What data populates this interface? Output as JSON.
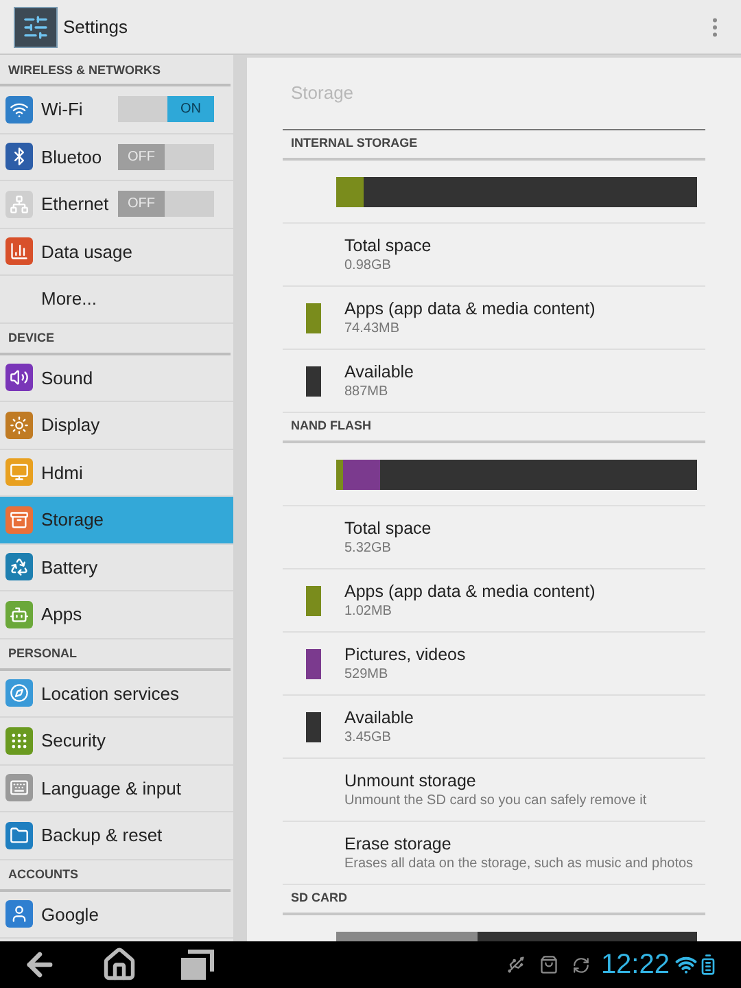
{
  "action_bar": {
    "title": "Settings"
  },
  "sidebar": {
    "sections": [
      {
        "header": "WIRELESS & NETWORKS",
        "items": [
          {
            "label": "Wi-Fi",
            "kind": "toggle",
            "on": true,
            "toggle_label": "ON",
            "selected": false
          },
          {
            "label": "Bluetoo",
            "kind": "toggle",
            "on": false,
            "toggle_label": "OFF",
            "selected": false
          },
          {
            "label": "Ethernet",
            "kind": "toggle",
            "on": false,
            "toggle_label": "OFF",
            "selected": false
          },
          {
            "label": "Data usage",
            "kind": "item",
            "selected": false
          },
          {
            "label": "More...",
            "kind": "item",
            "selected": false
          }
        ]
      },
      {
        "header": "DEVICE",
        "items": [
          {
            "label": "Sound",
            "kind": "item",
            "selected": false
          },
          {
            "label": "Display",
            "kind": "item",
            "selected": false
          },
          {
            "label": "Hdmi",
            "kind": "item",
            "selected": false
          },
          {
            "label": "Storage",
            "kind": "item",
            "selected": true
          },
          {
            "label": "Battery",
            "kind": "item",
            "selected": false
          },
          {
            "label": "Apps",
            "kind": "item",
            "selected": false
          }
        ]
      },
      {
        "header": "PERSONAL",
        "items": [
          {
            "label": "Location services",
            "kind": "item",
            "selected": false
          },
          {
            "label": "Security",
            "kind": "item",
            "selected": false
          },
          {
            "label": "Language & input",
            "kind": "item",
            "selected": false
          },
          {
            "label": "Backup & reset",
            "kind": "item",
            "selected": false
          }
        ]
      },
      {
        "header": "ACCOUNTS",
        "items": [
          {
            "label": "Google",
            "kind": "item",
            "selected": false
          }
        ]
      }
    ]
  },
  "storage": {
    "title": "Storage",
    "sections": [
      {
        "header": "INTERNAL STORAGE",
        "bar": [
          {
            "color": "#7a8c1c",
            "level": 0.075
          }
        ],
        "rows": [
          {
            "title": "Total space",
            "summary": "0.98GB"
          },
          {
            "title": "Apps (app data & media content)",
            "summary": "74.43MB",
            "color": "#7a8c1c"
          },
          {
            "title": "Available",
            "summary": "887MB",
            "color": "#333333"
          }
        ]
      },
      {
        "header": "NAND FLASH",
        "bar": [
          {
            "color": "#7a8c1c",
            "level": 0.02
          },
          {
            "color": "#7b3a8e",
            "level": 0.1
          }
        ],
        "rows": [
          {
            "title": "Total space",
            "summary": "5.32GB"
          },
          {
            "title": "Apps (app data & media content)",
            "summary": "1.02MB",
            "color": "#7a8c1c"
          },
          {
            "title": "Pictures, videos",
            "summary": "529MB",
            "color": "#7b3a8e"
          },
          {
            "title": "Available",
            "summary": "3.45GB",
            "color": "#333333"
          },
          {
            "title": "Unmount storage",
            "summary": "Unmount the SD card so you can safely remove it"
          },
          {
            "title": "Erase storage",
            "summary": "Erases all data on the storage, such as music and photos"
          }
        ]
      },
      {
        "header": "SD CARD",
        "bar": [
          {
            "color": "#888888",
            "level": 0.39
          }
        ]
      }
    ]
  },
  "status_bar": {
    "time": "12:22"
  }
}
